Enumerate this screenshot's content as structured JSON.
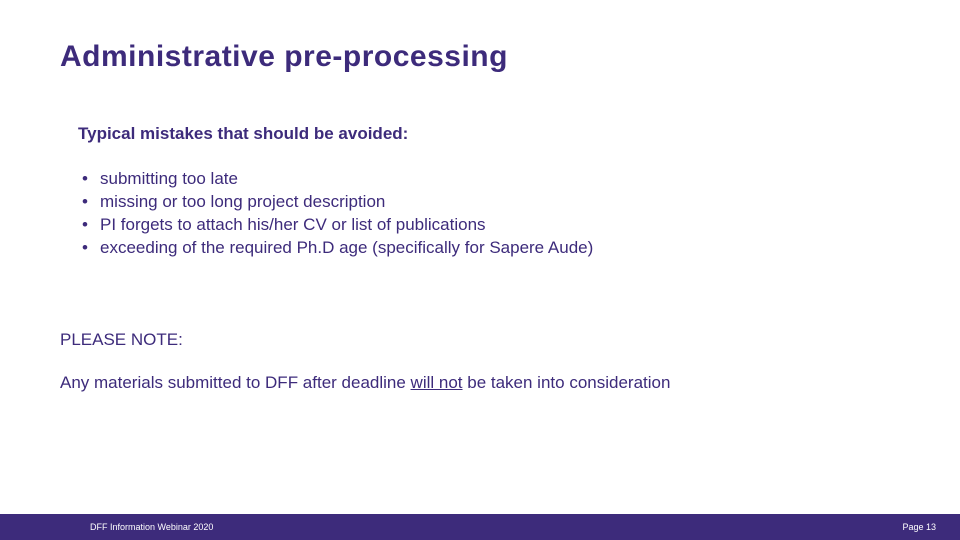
{
  "title": "Administrative pre-processing",
  "subheading": "Typical mistakes that should be avoided:",
  "bullets": [
    "submitting too late",
    "missing or too long project description",
    "PI forgets to attach his/her CV or list of publications",
    "exceeding of the required Ph.D age (specifically for Sapere Aude)"
  ],
  "note_label": "PLEASE NOTE:",
  "note_text_before": "Any materials submitted to DFF after deadline ",
  "note_text_underlined": "will not",
  "note_text_after": " be taken into consideration",
  "footer": {
    "left": "DFF Information Webinar 2020",
    "right": "Page 13"
  },
  "colors": {
    "primary": "#3d2b7b",
    "footer_bg": "#3d2b7b",
    "footer_text": "#ffffff",
    "background": "#ffffff"
  }
}
